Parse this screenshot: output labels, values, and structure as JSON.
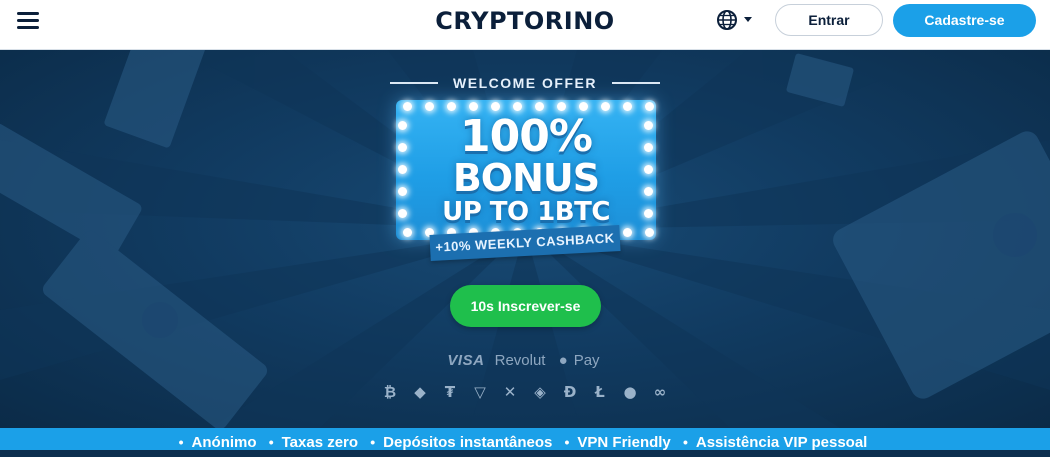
{
  "header": {
    "logo": "CRYPTORINO",
    "login_label": "Entrar",
    "signup_label": "Cadastre-se",
    "menu_icon": "hamburger-menu-icon",
    "language_icon": "globe-icon"
  },
  "hero": {
    "welcome": "WELCOME OFFER",
    "bonus_line1": "100%",
    "bonus_line2": "BONUS",
    "bonus_line3": "UP TO 1BTC",
    "cashback": "+10% WEEKLY CASHBACK",
    "cta_label": "10s Inscrever-se",
    "payments": [
      "VISA",
      "Revolut",
      "Pay"
    ],
    "crypto_icons": [
      "bitcoin",
      "ethereum",
      "tether",
      "tron",
      "ripple",
      "binance",
      "dogecoin",
      "litecoin",
      "shiba",
      "chainlink"
    ]
  },
  "features": [
    "Anónimo",
    "Taxas zero",
    "Depósitos instantâneos",
    "VPN Friendly",
    "Assistência VIP pessoal"
  ],
  "colors": {
    "accent": "#1ba0e8",
    "cta": "#1fbf4c",
    "hero_bg": "#113b61",
    "text_dark": "#0b1f3a"
  }
}
